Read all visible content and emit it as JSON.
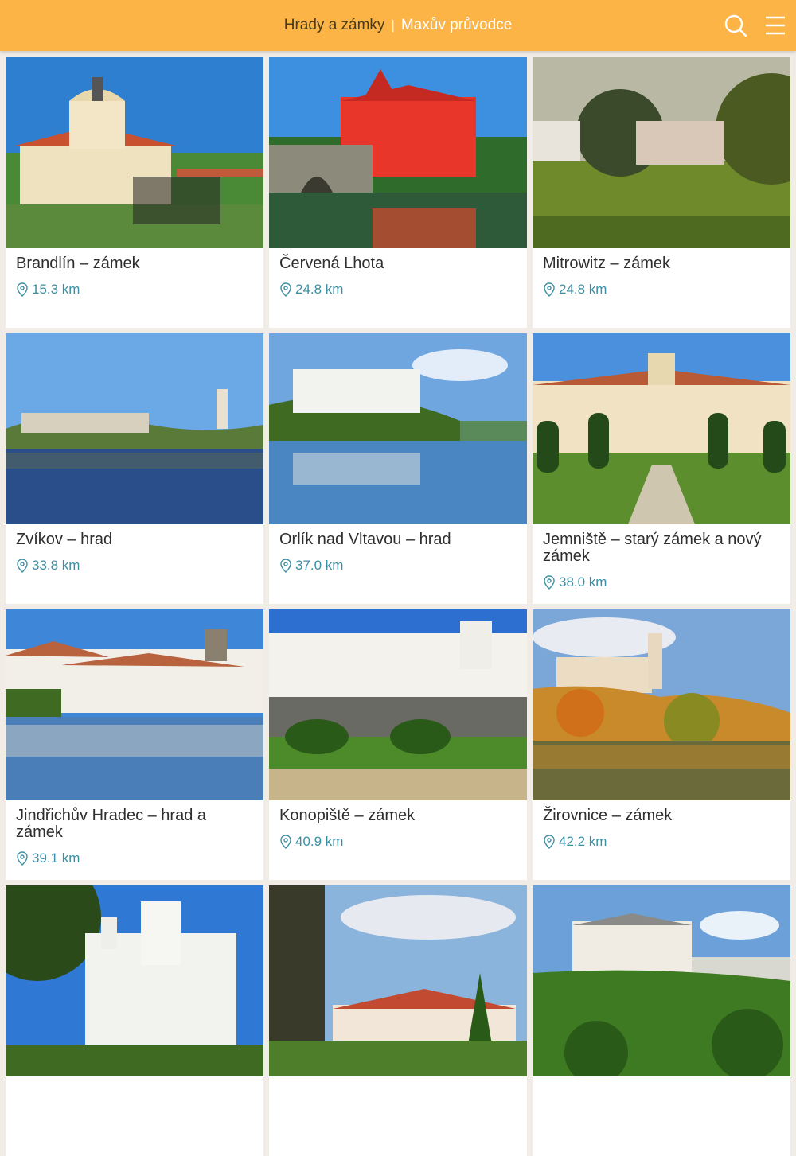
{
  "header": {
    "title": "Hrady a zámky",
    "separator": "|",
    "subtitle": "Maxův průvodce",
    "background": "#fbb445"
  },
  "colors": {
    "distance": "#3a8fa3",
    "title_text": "#2e2e2e"
  },
  "icons": {
    "search": "search-icon",
    "menu": "hamburger-menu-icon",
    "location": "location-pin-icon"
  },
  "places": [
    {
      "name": "Brandlín – zámek",
      "distance": "15.3 km"
    },
    {
      "name": "Červená Lhota",
      "distance": "24.8 km"
    },
    {
      "name": "Mitrowitz – zámek",
      "distance": "24.8 km"
    },
    {
      "name": "Zvíkov – hrad",
      "distance": "33.8 km"
    },
    {
      "name": "Orlík nad Vltavou – hrad",
      "distance": "37.0 km"
    },
    {
      "name": "Jemniště – starý zámek a nový zámek",
      "distance": "38.0 km"
    },
    {
      "name": "Jindřichův Hradec – hrad a zámek",
      "distance": "39.1 km"
    },
    {
      "name": "Konopiště – zámek",
      "distance": "40.9 km"
    },
    {
      "name": "Žirovnice – zámek",
      "distance": "42.2 km"
    },
    {
      "name": "",
      "distance": ""
    },
    {
      "name": "",
      "distance": ""
    },
    {
      "name": "",
      "distance": ""
    }
  ]
}
